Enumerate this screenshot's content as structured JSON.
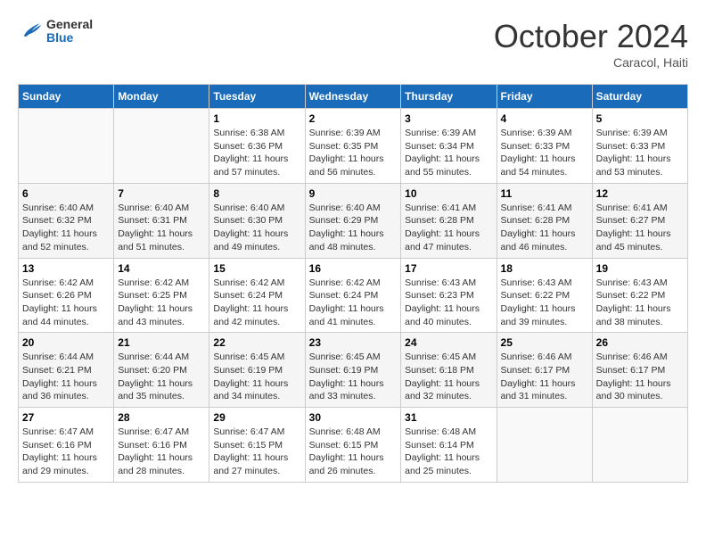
{
  "header": {
    "logo_general": "General",
    "logo_blue": "Blue",
    "month": "October 2024",
    "location": "Caracol, Haiti"
  },
  "days_of_week": [
    "Sunday",
    "Monday",
    "Tuesday",
    "Wednesday",
    "Thursday",
    "Friday",
    "Saturday"
  ],
  "weeks": [
    [
      {
        "day": "",
        "info": ""
      },
      {
        "day": "",
        "info": ""
      },
      {
        "day": "1",
        "info": "Sunrise: 6:38 AM\nSunset: 6:36 PM\nDaylight: 11 hours and 57 minutes."
      },
      {
        "day": "2",
        "info": "Sunrise: 6:39 AM\nSunset: 6:35 PM\nDaylight: 11 hours and 56 minutes."
      },
      {
        "day": "3",
        "info": "Sunrise: 6:39 AM\nSunset: 6:34 PM\nDaylight: 11 hours and 55 minutes."
      },
      {
        "day": "4",
        "info": "Sunrise: 6:39 AM\nSunset: 6:33 PM\nDaylight: 11 hours and 54 minutes."
      },
      {
        "day": "5",
        "info": "Sunrise: 6:39 AM\nSunset: 6:33 PM\nDaylight: 11 hours and 53 minutes."
      }
    ],
    [
      {
        "day": "6",
        "info": "Sunrise: 6:40 AM\nSunset: 6:32 PM\nDaylight: 11 hours and 52 minutes."
      },
      {
        "day": "7",
        "info": "Sunrise: 6:40 AM\nSunset: 6:31 PM\nDaylight: 11 hours and 51 minutes."
      },
      {
        "day": "8",
        "info": "Sunrise: 6:40 AM\nSunset: 6:30 PM\nDaylight: 11 hours and 49 minutes."
      },
      {
        "day": "9",
        "info": "Sunrise: 6:40 AM\nSunset: 6:29 PM\nDaylight: 11 hours and 48 minutes."
      },
      {
        "day": "10",
        "info": "Sunrise: 6:41 AM\nSunset: 6:28 PM\nDaylight: 11 hours and 47 minutes."
      },
      {
        "day": "11",
        "info": "Sunrise: 6:41 AM\nSunset: 6:28 PM\nDaylight: 11 hours and 46 minutes."
      },
      {
        "day": "12",
        "info": "Sunrise: 6:41 AM\nSunset: 6:27 PM\nDaylight: 11 hours and 45 minutes."
      }
    ],
    [
      {
        "day": "13",
        "info": "Sunrise: 6:42 AM\nSunset: 6:26 PM\nDaylight: 11 hours and 44 minutes."
      },
      {
        "day": "14",
        "info": "Sunrise: 6:42 AM\nSunset: 6:25 PM\nDaylight: 11 hours and 43 minutes."
      },
      {
        "day": "15",
        "info": "Sunrise: 6:42 AM\nSunset: 6:24 PM\nDaylight: 11 hours and 42 minutes."
      },
      {
        "day": "16",
        "info": "Sunrise: 6:42 AM\nSunset: 6:24 PM\nDaylight: 11 hours and 41 minutes."
      },
      {
        "day": "17",
        "info": "Sunrise: 6:43 AM\nSunset: 6:23 PM\nDaylight: 11 hours and 40 minutes."
      },
      {
        "day": "18",
        "info": "Sunrise: 6:43 AM\nSunset: 6:22 PM\nDaylight: 11 hours and 39 minutes."
      },
      {
        "day": "19",
        "info": "Sunrise: 6:43 AM\nSunset: 6:22 PM\nDaylight: 11 hours and 38 minutes."
      }
    ],
    [
      {
        "day": "20",
        "info": "Sunrise: 6:44 AM\nSunset: 6:21 PM\nDaylight: 11 hours and 36 minutes."
      },
      {
        "day": "21",
        "info": "Sunrise: 6:44 AM\nSunset: 6:20 PM\nDaylight: 11 hours and 35 minutes."
      },
      {
        "day": "22",
        "info": "Sunrise: 6:45 AM\nSunset: 6:19 PM\nDaylight: 11 hours and 34 minutes."
      },
      {
        "day": "23",
        "info": "Sunrise: 6:45 AM\nSunset: 6:19 PM\nDaylight: 11 hours and 33 minutes."
      },
      {
        "day": "24",
        "info": "Sunrise: 6:45 AM\nSunset: 6:18 PM\nDaylight: 11 hours and 32 minutes."
      },
      {
        "day": "25",
        "info": "Sunrise: 6:46 AM\nSunset: 6:17 PM\nDaylight: 11 hours and 31 minutes."
      },
      {
        "day": "26",
        "info": "Sunrise: 6:46 AM\nSunset: 6:17 PM\nDaylight: 11 hours and 30 minutes."
      }
    ],
    [
      {
        "day": "27",
        "info": "Sunrise: 6:47 AM\nSunset: 6:16 PM\nDaylight: 11 hours and 29 minutes."
      },
      {
        "day": "28",
        "info": "Sunrise: 6:47 AM\nSunset: 6:16 PM\nDaylight: 11 hours and 28 minutes."
      },
      {
        "day": "29",
        "info": "Sunrise: 6:47 AM\nSunset: 6:15 PM\nDaylight: 11 hours and 27 minutes."
      },
      {
        "day": "30",
        "info": "Sunrise: 6:48 AM\nSunset: 6:15 PM\nDaylight: 11 hours and 26 minutes."
      },
      {
        "day": "31",
        "info": "Sunrise: 6:48 AM\nSunset: 6:14 PM\nDaylight: 11 hours and 25 minutes."
      },
      {
        "day": "",
        "info": ""
      },
      {
        "day": "",
        "info": ""
      }
    ]
  ]
}
